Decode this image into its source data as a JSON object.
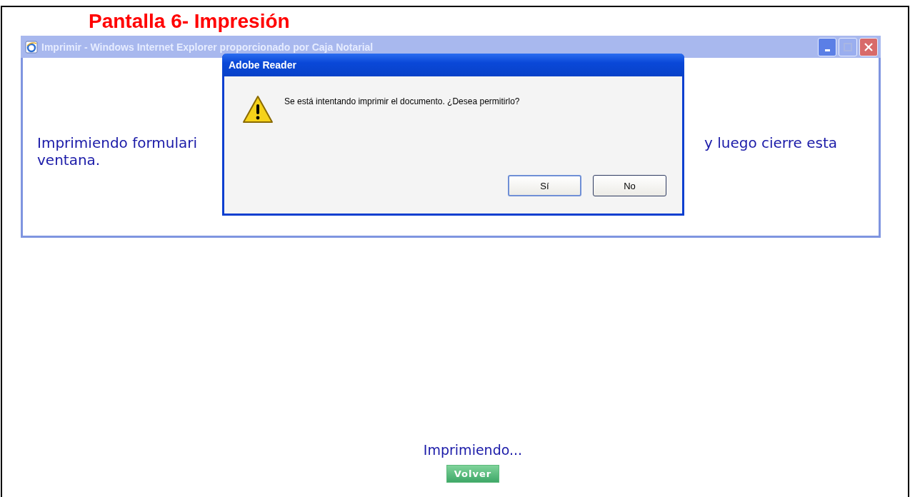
{
  "document_title": "Pantalla 6- Impresión",
  "browser_window": {
    "title": "Imprimir - Windows Internet Explorer proporcionado por Caja Notarial",
    "active": false,
    "message_left": "Imprimiendo formulari",
    "message_right": "y luego cierre esta",
    "message_line2": "ventana."
  },
  "dialog": {
    "title": "Adobe Reader",
    "message": "Se está intentando imprimir el documento. ¿Desea permitirlo?",
    "buttons": [
      {
        "label": "Sí",
        "default": true
      },
      {
        "label": "No",
        "default": false
      }
    ]
  },
  "status": "Imprimiendo...",
  "back_button": "Volver"
}
